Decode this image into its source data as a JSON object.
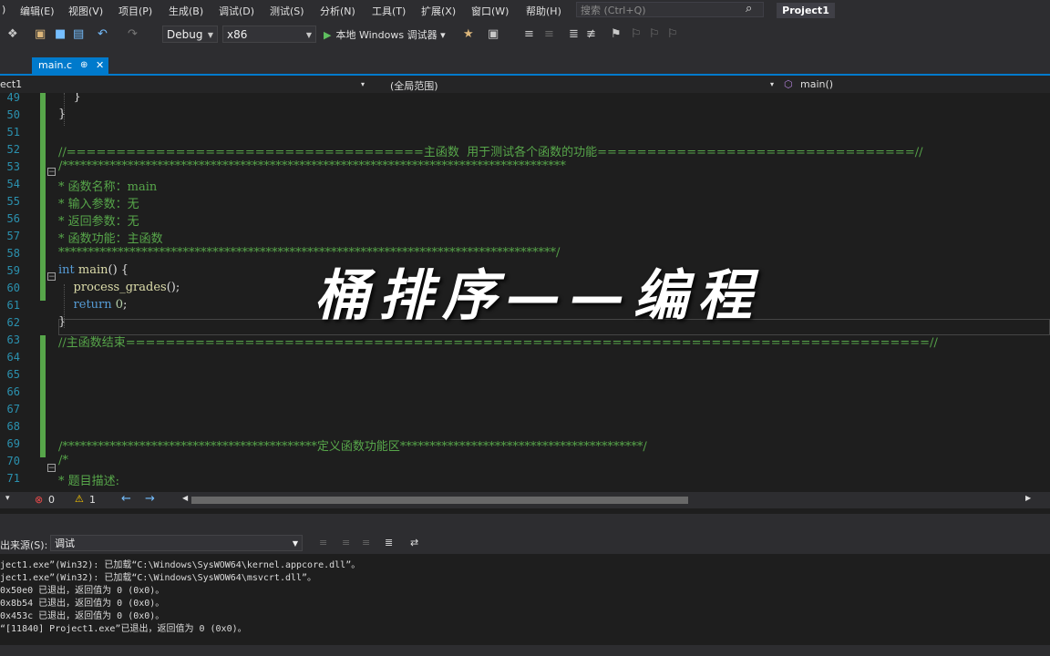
{
  "menu": {
    "items": [
      ") ",
      "编辑(E)",
      "视图(V)",
      "项目(P)",
      "生成(B)",
      "调试(D)",
      "测试(S)",
      "分析(N)",
      "工具(T)",
      "扩展(X)",
      "窗口(W)",
      "帮助(H)"
    ],
    "search_placeholder": "搜索 (Ctrl+Q)",
    "project_name": "Project1"
  },
  "toolbar": {
    "config": "Debug",
    "platform": "x86",
    "run_label": "本地 Windows 调试器"
  },
  "tab": {
    "label": "main.c",
    "pin": "ᵖ",
    "close": "✕"
  },
  "navbar": {
    "project": "ect1",
    "scope": "(全局范围)",
    "member": "main()"
  },
  "code_lines": [
    {
      "n": "49",
      "t": "    }"
    },
    {
      "n": "50",
      "t": "}"
    },
    {
      "n": "51",
      "t": ""
    },
    {
      "n": "52",
      "t": "//====================================主函数  用于测试各个函数的功能================================//"
    },
    {
      "n": "53",
      "t": "/*************************************************************************************"
    },
    {
      "n": "54",
      "t": "* 函数名称：main"
    },
    {
      "n": "55",
      "t": "* 输入参数：无"
    },
    {
      "n": "56",
      "t": "* 返回参数：无"
    },
    {
      "n": "57",
      "t": "* 函数功能：主函数"
    },
    {
      "n": "58",
      "t": "************************************************************************************/"
    },
    {
      "n": "59",
      "t": "int main() {"
    },
    {
      "n": "60",
      "t": "    process_grades();"
    },
    {
      "n": "61",
      "t": "    return 0;"
    },
    {
      "n": "62",
      "t": "}"
    },
    {
      "n": "63",
      "t": "//主函数结束=================================================================================//"
    },
    {
      "n": "64",
      "t": ""
    },
    {
      "n": "65",
      "t": ""
    },
    {
      "n": "66",
      "t": ""
    },
    {
      "n": "67",
      "t": ""
    },
    {
      "n": "68",
      "t": ""
    },
    {
      "n": "69",
      "t": "/*******************************************定义函数功能区*****************************************/"
    },
    {
      "n": "70",
      "t": "/*"
    },
    {
      "n": "71",
      "t": "* 题目描述:"
    }
  ],
  "overlay_title": "桶排序——编程",
  "status": {
    "errors": "0",
    "warnings": "1"
  },
  "output": {
    "source_label": "出来源(S):",
    "source_value": "调试",
    "lines": [
      "ject1.exe”(Win32): 已加载“C:\\Windows\\SysWOW64\\kernel.appcore.dll”。",
      "ject1.exe”(Win32): 已加载“C:\\Windows\\SysWOW64\\msvcrt.dll”。",
      "0x50e0 已退出，返回值为 0 (0x0)。",
      "0x8b54 已退出，返回值为 0 (0x0)。",
      "0x453c 已退出，返回值为 0 (0x0)。",
      "“[11840] Project1.exe”已退出，返回值为 0 (0x0)。"
    ]
  }
}
